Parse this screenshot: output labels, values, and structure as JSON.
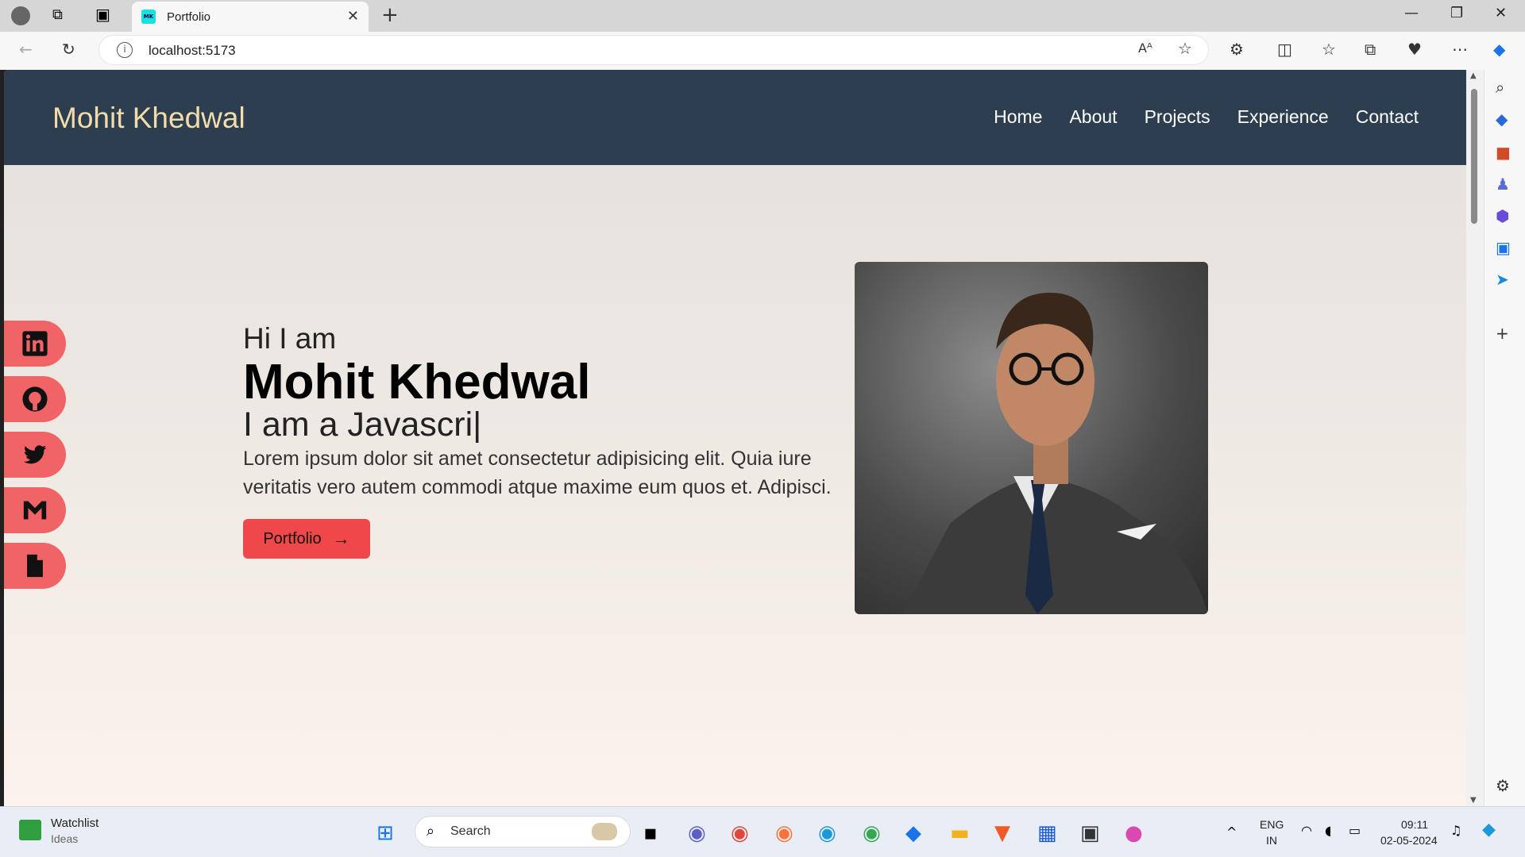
{
  "browser": {
    "tab_title": "Portfolio",
    "favicon_text": "MK",
    "url": "localhost:5173"
  },
  "site": {
    "brand": "Mohit Khedwal",
    "nav": [
      "Home",
      "About",
      "Projects",
      "Experience",
      "Contact"
    ],
    "hero": {
      "greeting": "Hi I am",
      "name": "Mohit Khedwal",
      "typed": "I am a Javascri|",
      "description": "Lorem ipsum dolor sit amet consectetur adipisicing elit. Quia iure veritatis vero autem commodi atque maxime eum quos et. Adipisci.",
      "button": "Portfolio"
    },
    "socials": [
      "linkedin-icon",
      "github-icon",
      "twitter-icon",
      "gmail-icon",
      "document-icon"
    ]
  },
  "taskbar": {
    "widget_title": "Watchlist",
    "widget_sub": "Ideas",
    "search": "Search",
    "lang_top": "ENG",
    "lang_bottom": "IN",
    "time": "09:11",
    "date": "02-05-2024"
  },
  "colors": {
    "navbar": "#2c3e50",
    "brand": "#f3dcaa",
    "accent": "#f0484a",
    "social": "#f06466"
  }
}
